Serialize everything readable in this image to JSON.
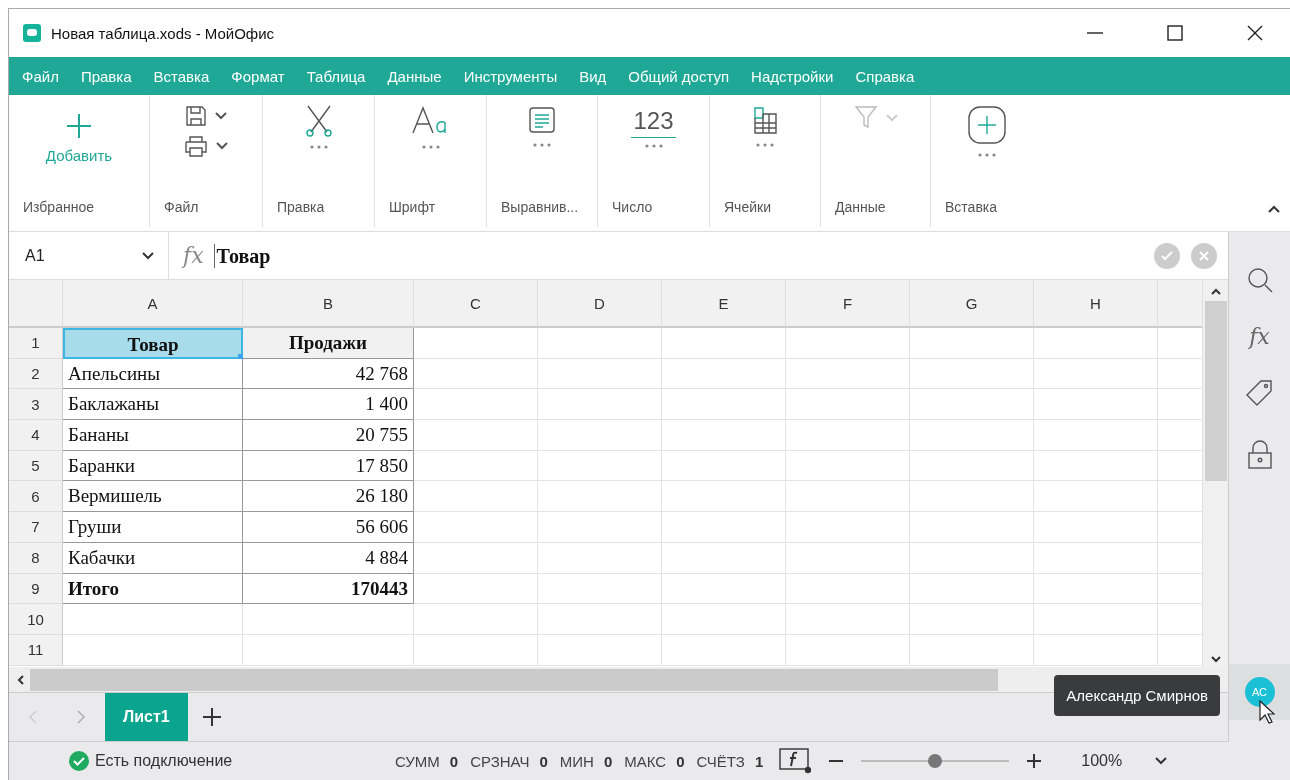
{
  "window": {
    "title": "Новая таблица.xods - МойОфис"
  },
  "menu": [
    "Файл",
    "Правка",
    "Вставка",
    "Формат",
    "Таблица",
    "Данные",
    "Инструменты",
    "Вид",
    "Общий доступ",
    "Надстройки",
    "Справка"
  ],
  "ribbon": [
    {
      "kind": "add",
      "label": "Избранное",
      "button": "Добавить",
      "disabled": false
    },
    {
      "kind": "file",
      "label": "Файл",
      "disabled": false
    },
    {
      "kind": "cut",
      "label": "Правка",
      "disabled": false
    },
    {
      "kind": "font",
      "label": "Шрифт",
      "disabled": false
    },
    {
      "kind": "align",
      "label": "Выравнив...",
      "disabled": false
    },
    {
      "kind": "number",
      "label": "Число",
      "icon_text": "123",
      "disabled": false
    },
    {
      "kind": "cells",
      "label": "Ячейки",
      "disabled": false
    },
    {
      "kind": "filter",
      "label": "Данные",
      "disabled": true
    },
    {
      "kind": "insert",
      "label": "Вставка",
      "disabled": false
    }
  ],
  "formula_bar": {
    "cell_ref": "A1",
    "fx": "fx",
    "value": "Товар"
  },
  "sheet": {
    "columns": [
      "A",
      "B",
      "C",
      "D",
      "E",
      "F",
      "G",
      "H"
    ],
    "rows": [
      {
        "number": "1",
        "kind": "header",
        "cells": [
          {
            "text": "Товар",
            "selected": true
          },
          {
            "text": "Продажи",
            "selected": false
          }
        ]
      },
      {
        "number": "2",
        "kind": "data",
        "cells": [
          {
            "text": "Апельсины",
            "selected": false
          },
          {
            "text": "42 768",
            "selected": false
          }
        ]
      },
      {
        "number": "3",
        "kind": "data",
        "cells": [
          {
            "text": "Баклажаны",
            "selected": false
          },
          {
            "text": "1 400",
            "selected": false
          }
        ]
      },
      {
        "number": "4",
        "kind": "data",
        "cells": [
          {
            "text": "Бананы",
            "selected": false
          },
          {
            "text": "20 755",
            "selected": false
          }
        ]
      },
      {
        "number": "5",
        "kind": "data",
        "cells": [
          {
            "text": "Баранки",
            "selected": false
          },
          {
            "text": "17 850",
            "selected": false
          }
        ]
      },
      {
        "number": "6",
        "kind": "data",
        "cells": [
          {
            "text": "Вермишель",
            "selected": false
          },
          {
            "text": "26 180",
            "selected": false
          }
        ]
      },
      {
        "number": "7",
        "kind": "data",
        "cells": [
          {
            "text": "Груши",
            "selected": false
          },
          {
            "text": "56 606",
            "selected": false
          }
        ]
      },
      {
        "number": "8",
        "kind": "data",
        "cells": [
          {
            "text": "Кабачки",
            "selected": false
          },
          {
            "text": "4 884",
            "selected": false
          }
        ]
      },
      {
        "number": "9",
        "kind": "total",
        "cells": [
          {
            "text": "Итого",
            "selected": false
          },
          {
            "text": "170443",
            "selected": false
          }
        ]
      },
      {
        "number": "10",
        "kind": "empty",
        "cells": []
      },
      {
        "number": "11",
        "kind": "empty",
        "cells": []
      }
    ]
  },
  "sidebar": [
    {
      "kind": "search"
    },
    {
      "kind": "fx",
      "text": "fx"
    },
    {
      "kind": "tag"
    },
    {
      "kind": "lock"
    }
  ],
  "user": {
    "initials": "АС",
    "tooltip": "Александр Смирнов"
  },
  "sheet_tabs": [
    {
      "label": "Лист1",
      "selected": true
    }
  ],
  "status_bar": {
    "connection": "Есть подключение",
    "stats": [
      {
        "label": "СУММ",
        "value": "0"
      },
      {
        "label": "СРЗНАЧ",
        "value": "0"
      },
      {
        "label": "МИН",
        "value": "0"
      },
      {
        "label": "МАКС",
        "value": "0"
      },
      {
        "label": "СЧЁТЗ",
        "value": "1"
      }
    ],
    "zoom": {
      "level": 0.5,
      "reading": "100%"
    }
  }
}
